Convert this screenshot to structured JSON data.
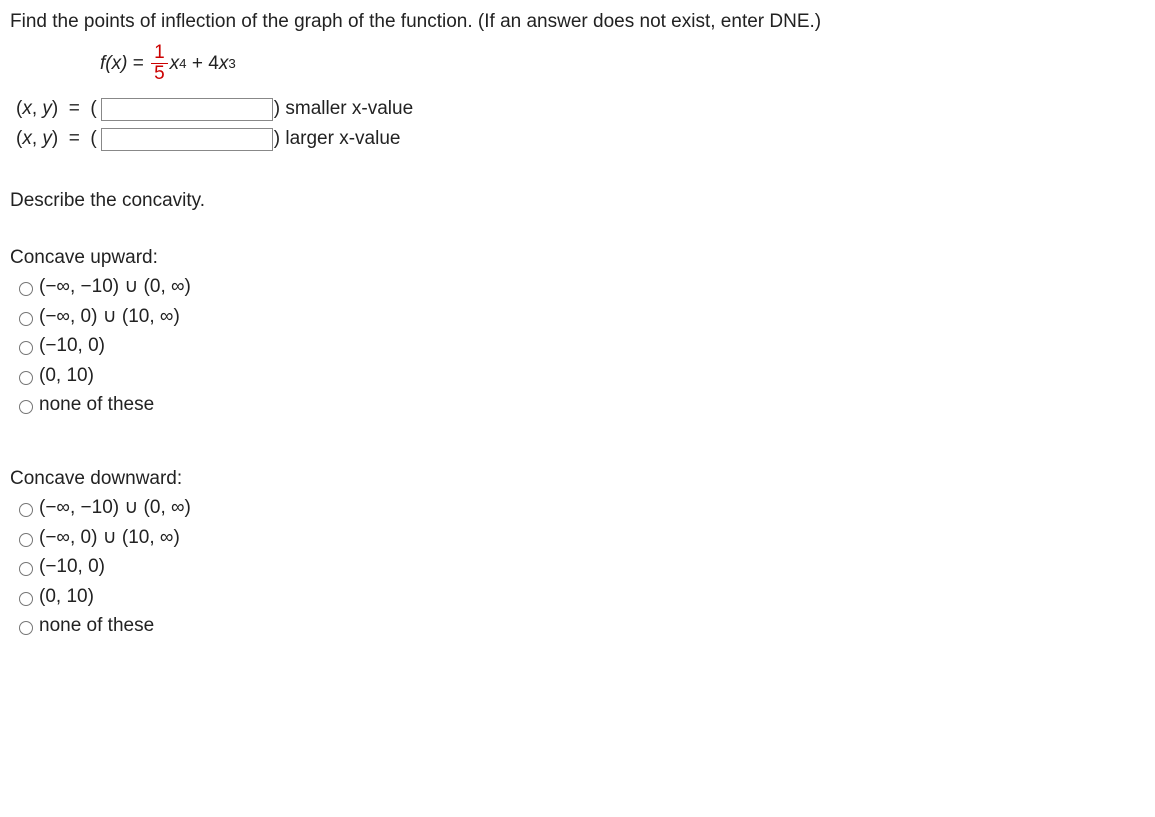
{
  "question": "Find the points of inflection of the graph of the function. (If an answer does not exist, enter DNE.)",
  "func": {
    "lhs": "f(x)",
    "eq": " = ",
    "num": "1",
    "den": "5",
    "term1a": "x",
    "term1exp": "4",
    "plus": " + 4",
    "term2a": "x",
    "term2exp": "3"
  },
  "rows": [
    {
      "label_pre": "(",
      "label_x": "x",
      "label_comma": ", ",
      "label_y": "y",
      "label_post": ")  =  (",
      "after": ") smaller ",
      "after_ital": "x",
      "after2": "-value"
    },
    {
      "label_pre": "(",
      "label_x": "x",
      "label_comma": ", ",
      "label_y": "y",
      "label_post": ")  =  (",
      "after": ") larger ",
      "after_ital": "x",
      "after2": "-value"
    }
  ],
  "concavity_heading": "Describe the concavity.",
  "group_up": "Concave upward:",
  "group_down": "Concave downward:",
  "options": [
    "(−∞, −10) ∪ (0, ∞)",
    "(−∞, 0) ∪ (10, ∞)",
    "(−10, 0)",
    "(0, 10)",
    "none of these"
  ]
}
